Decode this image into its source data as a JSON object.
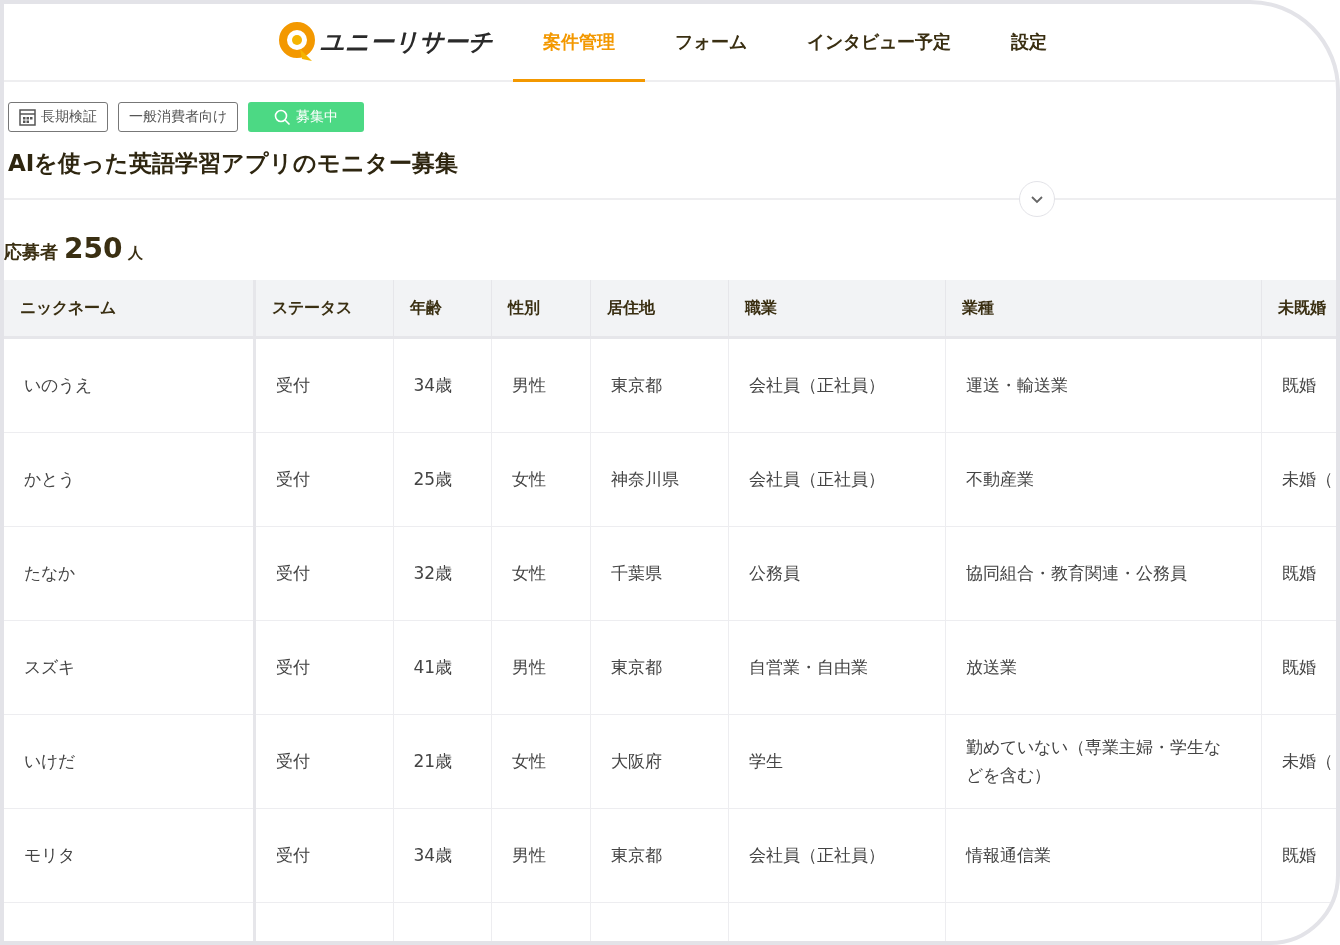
{
  "header": {
    "logo_text": "ユニーリサーチ",
    "tabs": [
      {
        "label": "案件管理",
        "selected": true
      },
      {
        "label": "フォーム",
        "selected": false
      },
      {
        "label": "インタビュー予定",
        "selected": false
      },
      {
        "label": "設定",
        "selected": false
      }
    ]
  },
  "tags": [
    {
      "label": "長期検証",
      "kind": "calendar"
    },
    {
      "label": "一般消費者向け",
      "kind": "plain"
    },
    {
      "label": "募集中",
      "kind": "status"
    }
  ],
  "title": "AIを使った英語学習アプリのモニター募集",
  "applicants": {
    "label": "応募者",
    "count": "250",
    "unit": "人"
  },
  "table": {
    "columns": [
      "ニックネーム",
      "ステータス",
      "年齢",
      "性別",
      "居住地",
      "職業",
      "業種",
      "未既婚"
    ],
    "rows": [
      [
        "いのうえ",
        "受付",
        "34歳",
        "男性",
        "東京都",
        "会社員（正社員）",
        "運送・輸送業",
        "既婚"
      ],
      [
        "かとう",
        "受付",
        "25歳",
        "女性",
        "神奈川県",
        "会社員（正社員）",
        "不動産業",
        "未婚（"
      ],
      [
        "たなか",
        "受付",
        "32歳",
        "女性",
        "千葉県",
        "公務員",
        "協同組合・教育関連・公務員",
        "既婚"
      ],
      [
        "スズキ",
        "受付",
        "41歳",
        "男性",
        "東京都",
        "自営業・自由業",
        "放送業",
        "既婚"
      ],
      [
        "いけだ",
        "受付",
        "21歳",
        "女性",
        "大阪府",
        "学生",
        "勤めていない（専業主婦・学生などを含む）",
        "未婚（"
      ],
      [
        "モリタ",
        "受付",
        "34歳",
        "男性",
        "東京都",
        "会社員（正社員）",
        "情報通信業",
        "既婚"
      ]
    ]
  }
}
